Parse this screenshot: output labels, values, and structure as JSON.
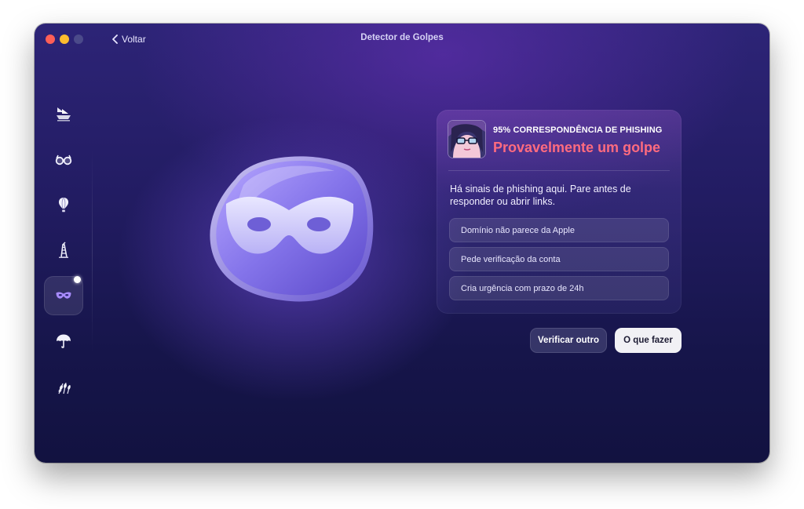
{
  "window": {
    "title": "Detector de Golpes",
    "back_label": "Voltar"
  },
  "sidebar": {
    "items": [
      {
        "name": "ship-icon",
        "active": false
      },
      {
        "name": "glasses-icon",
        "active": false
      },
      {
        "name": "hot-air-balloon-icon",
        "active": false
      },
      {
        "name": "tower-icon",
        "active": false
      },
      {
        "name": "mask-icon",
        "active": true
      },
      {
        "name": "umbrella-icon",
        "active": false
      },
      {
        "name": "wheat-icon",
        "active": false
      }
    ]
  },
  "hero": {
    "icon": "mask-icon"
  },
  "result": {
    "match_label": "95% CORRESPONDÊNCIA DE PHISHING",
    "verdict": "Provavelmente um golpe",
    "message": "Há sinais de phishing aqui. Pare antes de responder ou abrir links.",
    "reasons": [
      "Domínio não parece da Apple",
      "Pede verificação da conta",
      "Cria urgência com prazo de 24h"
    ]
  },
  "actions": {
    "check_another": "Verificar outro",
    "what_to_do": "O que fazer"
  },
  "colors": {
    "verdict": "#ff6b7f",
    "accent": "#8f7cf0",
    "background": "#221c62"
  }
}
